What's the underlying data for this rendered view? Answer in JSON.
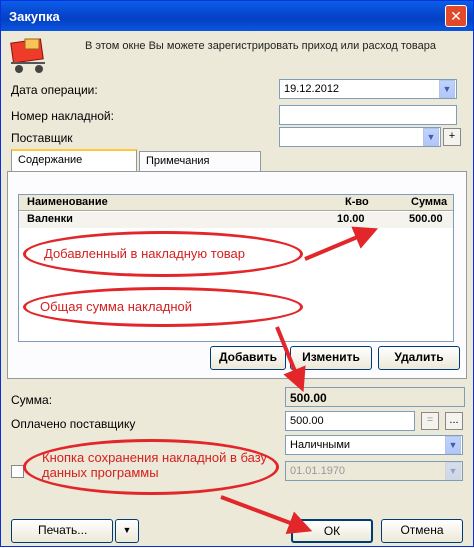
{
  "window": {
    "title": "Закупка",
    "close_glyph": "✕"
  },
  "info_text": "В этом окне Вы можете зарегистрировать приход или расход товара",
  "form": {
    "date_label": "Дата операции:",
    "date_value": "19.12.2012",
    "invoice_label": "Номер накладной:",
    "supplier_label": "Поставщик",
    "supplier_add_glyph": "+"
  },
  "tabs": [
    {
      "label": "Содержание"
    },
    {
      "label": "Примечания"
    }
  ],
  "table": {
    "columns": [
      "Наименование",
      "К-во",
      "Сумма"
    ],
    "rows": [
      {
        "name": "Валенки",
        "qty": "10.00",
        "sum": "500.00"
      }
    ]
  },
  "buttons": {
    "add": "Добавить",
    "edit": "Изменить",
    "delete": "Удалить",
    "print": "Печать...",
    "ok": "ОК",
    "cancel": "Отмена"
  },
  "totals": {
    "sum_label": "Сумма:",
    "sum_value": "500.00",
    "paid_label": "Оплачено поставщику",
    "paid_value": "500.00",
    "eq_glyph": "=",
    "more_glyph": "...",
    "payment_method": "Наличными",
    "date_disabled": "01.01.1970"
  },
  "annotations": {
    "a1": "Добавленный в накладную товар",
    "a2": "Общая сумма накладной",
    "a3": "Кнопка сохранения накладной в базу данных программы"
  },
  "colors": {
    "annotation": "#e2262a",
    "titlebar": "#0a5ee9"
  },
  "icons": [
    "cart-icon",
    "chevron-down-icon",
    "close-icon"
  ]
}
